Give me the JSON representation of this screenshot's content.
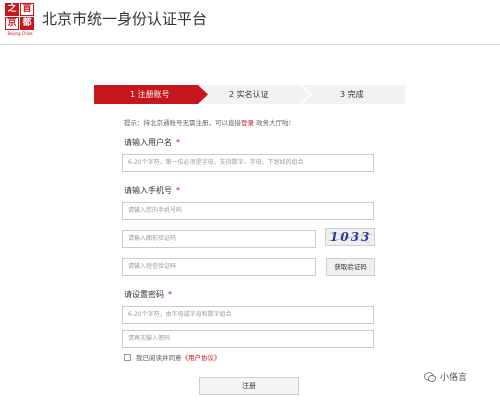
{
  "header": {
    "logo": {
      "chars": [
        "之",
        "首",
        "京",
        "都"
      ],
      "subtitle": "Beijing China"
    },
    "title": "北京市统一身份认证平台"
  },
  "steps": [
    {
      "label": "1 注册账号",
      "state": "active"
    },
    {
      "label": "2 实名认证",
      "state": "inactive"
    },
    {
      "label": "3 完成",
      "state": "inactive"
    }
  ],
  "hint": {
    "prefix": "提示：持北京通账号无需注册，可以直接",
    "link": "登录",
    "suffix": " 政务大厅啦!"
  },
  "form": {
    "username_label": "请输入用户名",
    "username_placeholder": "6-20个字符，第一位必须是字母，支持数字、字母、下划线的组合",
    "phone_label": "请输入手机号",
    "phone_placeholder": "请输入您的手机号码",
    "image_code_placeholder": "请输入图形验证码",
    "captcha_text": "1033",
    "sms_code_placeholder": "请输入短信验证码",
    "sms_button": "获取验证码",
    "password_label": "请设置密码",
    "password_placeholder": "6-20个字符，由字母或字母和数字组合",
    "password_confirm_placeholder": "请再次输入密码",
    "required_mark": "*",
    "agree_prefix": "我已阅读并同意",
    "agree_link": "《用户协议》",
    "submit": "注册"
  },
  "watermark": {
    "text": "小佫言"
  },
  "colors": {
    "accent": "#c8161d",
    "border": "#cccccc",
    "step_inactive": "#f2f2f2"
  }
}
